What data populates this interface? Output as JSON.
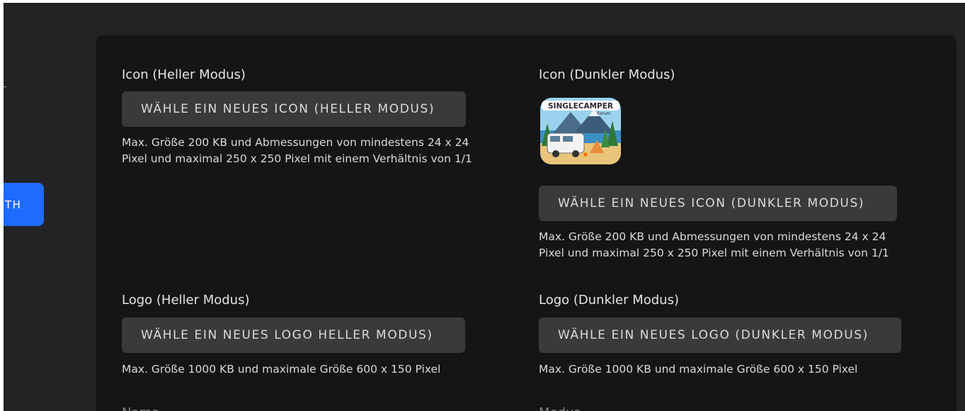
{
  "sidebar": {
    "button_label": "TH"
  },
  "icon_light": {
    "title": "Icon (Heller Modus)",
    "button_label": "WÄHLE EIN NEUES ICON (HELLER MODUS)",
    "hint_line1": "Max. Größe 200 KB und Abmessungen von mindestens 24 x 24",
    "hint_line2": "Pixel und maximal 250 x 250 Pixel mit einem Verhältnis von 1/1"
  },
  "icon_dark": {
    "title": "Icon (Dunkler Modus)",
    "preview_text_main": "SINGLECAMPER",
    "preview_text_sub": "Forum",
    "button_label": "WÄHLE EIN NEUES ICON (DUNKLER MODUS)",
    "hint_line1": "Max. Größe 200 KB und Abmessungen von mindestens 24 x 24",
    "hint_line2": "Pixel und maximal 250 x 250 Pixel mit einem Verhältnis von 1/1"
  },
  "logo_light": {
    "title": "Logo (Heller Modus)",
    "button_label": "WÄHLE EIN NEUES LOGO HELLER MODUS)",
    "hint": "Max. Größe 1000 KB und maximale Größe 600 x 150 Pixel"
  },
  "logo_dark": {
    "title": "Logo (Dunkler Modus)",
    "button_label": "WÄHLE EIN NEUES LOGO (DUNKLER MODUS)",
    "hint": "Max. Größe 1000 KB und maximale Größe 600 x 150 Pixel"
  },
  "next_row": {
    "left_label": "Name",
    "right_label": "Modus"
  },
  "colors": {
    "app_bg": "#232325",
    "panel_bg": "#151515",
    "button_bg": "#3a3a3b",
    "accent": "#1f6bff"
  }
}
